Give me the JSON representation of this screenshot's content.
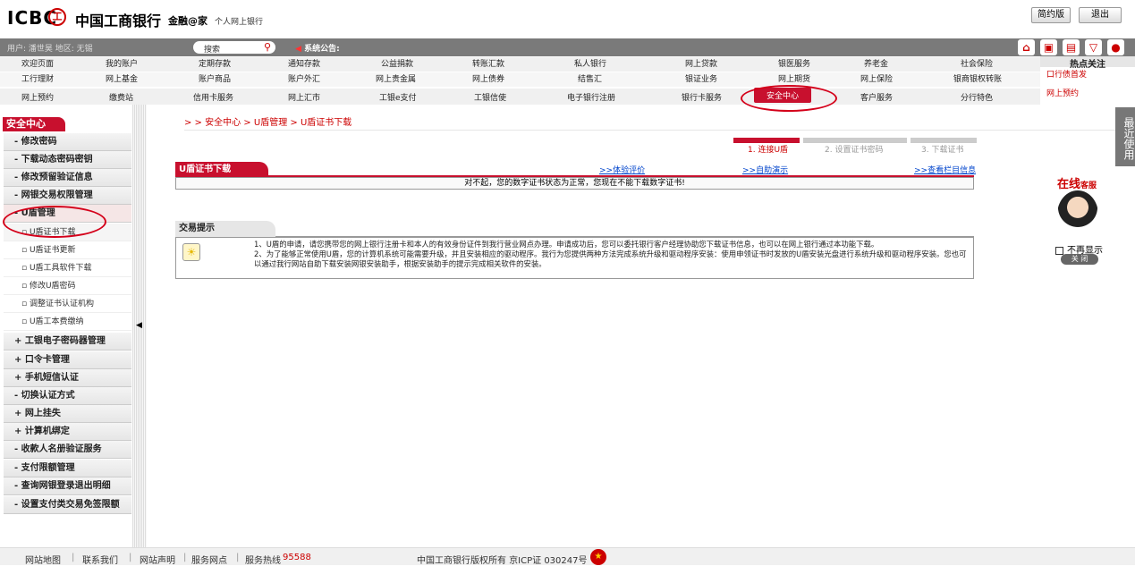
{
  "header": {
    "logo_text": "ICBC",
    "logo_mark": "工",
    "logo_cn": "中国工商银行",
    "brand": "金融@家",
    "subtitle": "个人网上银行",
    "simple_label": "简约版",
    "exit_label": "退出"
  },
  "userbar": {
    "user_info": "用户: 潘世昊  地区: 无锡",
    "search_placeholder": "搜索",
    "notice_label": "系统公告:",
    "icons": [
      "home-icon",
      "cart-icon",
      "card-icon",
      "inbox-icon",
      "chat-icon"
    ]
  },
  "menu": {
    "row1": [
      "欢迎页面",
      "我的账户",
      "定期存款",
      "通知存款",
      "公益捐款",
      "转账汇款",
      "私人银行",
      "网上贷款",
      "银医服务",
      "养老金",
      "社会保险"
    ],
    "row2": [
      "工行理财",
      "网上基金",
      "账户商品",
      "账户外汇",
      "网上贵金属",
      "网上债券",
      "结售汇",
      "银证业务",
      "网上期货",
      "网上保险",
      "银商银权转账"
    ],
    "row3": [
      "网上预约",
      "缴费站",
      "信用卡服务",
      "网上汇市",
      "工银e支付",
      "工银信使",
      "电子银行注册",
      "银行卡服务",
      "安全中心",
      "客户服务",
      "分行特色"
    ]
  },
  "hot": {
    "title": "热点关注",
    "items": [
      "口行债首发",
      "网上预约"
    ]
  },
  "sidebar": {
    "title": "安全中心",
    "items": [
      {
        "label": "修改密码",
        "prefix": "-"
      },
      {
        "label": "下载动态密码密钥",
        "prefix": "-"
      },
      {
        "label": "修改预留验证信息",
        "prefix": "-"
      },
      {
        "label": "网银交易权限管理",
        "prefix": "-"
      },
      {
        "label": "U盾管理",
        "prefix": "-"
      }
    ],
    "subitems": [
      "U盾证书下载",
      "U盾证书更新",
      "U盾工具软件下载",
      "修改U盾密码",
      "调整证书认证机构",
      "U盾工本费缴纳"
    ],
    "items2": [
      {
        "label": "工银电子密码器管理",
        "prefix": "+"
      },
      {
        "label": "口令卡管理",
        "prefix": "+"
      },
      {
        "label": "手机短信认证",
        "prefix": "+"
      },
      {
        "label": "切换认证方式",
        "prefix": "-"
      },
      {
        "label": "网上挂失",
        "prefix": "+"
      },
      {
        "label": "计算机绑定",
        "prefix": "+"
      },
      {
        "label": "收款人名册验证服务",
        "prefix": "-"
      },
      {
        "label": "支付限额管理",
        "prefix": "-"
      },
      {
        "label": "查询网银登录退出明细",
        "prefix": "-"
      },
      {
        "label": "设置支付类交易免签限额",
        "prefix": "-"
      }
    ]
  },
  "breadcrumb": {
    "sep": "> >",
    "items": [
      "安全中心",
      "U盾管理",
      "U盾证书下载"
    ]
  },
  "steps": [
    "1. 连接U盾",
    "2. 设置证书密码",
    "3. 下载证书"
  ],
  "download": {
    "tab_title": "U盾证书下载",
    "link1": ">>体验评价",
    "link2": ">>自助演示",
    "link3": ">>查看栏目信息",
    "message": "对不起，您的数字证书状态为正常，您现在不能下载数字证书!"
  },
  "tips": {
    "title": "交易提示",
    "line1": "1、U盾的申请，请您携带您的网上银行注册卡和本人的有效身份证件到我行营业网点办理。申请成功后，您可以委托银行客户经理协助您下载证书信息，也可以在网上银行通过本功能下载。",
    "line2": "2、为了能够正常使用U盾，您的计算机系统可能需要升级，并且安装相应的驱动程序。我行为您提供两种方法完成系统升级和驱动程序安装：使用申领证书时发放的U盾安装光盘进行系统升级和驱动程序安装。您也可以通过我行网站自助下载安装网银安装助手，根据安装助手的提示完成相关软件的安装。"
  },
  "rightbar": {
    "label": "最近使用"
  },
  "online": {
    "title": "在线",
    "title_suffix": "客服",
    "no_show": "不再显示",
    "close": "关 闭"
  },
  "footer": {
    "sitemap": "网站地图",
    "contact": "联系我们",
    "statement": "网站声明",
    "outlets": "服务网点",
    "hotline_label": "服务热线",
    "hotline": "95588",
    "copyright": "中国工商银行版权所有  京ICP证 030247号"
  },
  "colors": {
    "brand_red": "#c8102e",
    "link_blue": "#0044cc"
  }
}
